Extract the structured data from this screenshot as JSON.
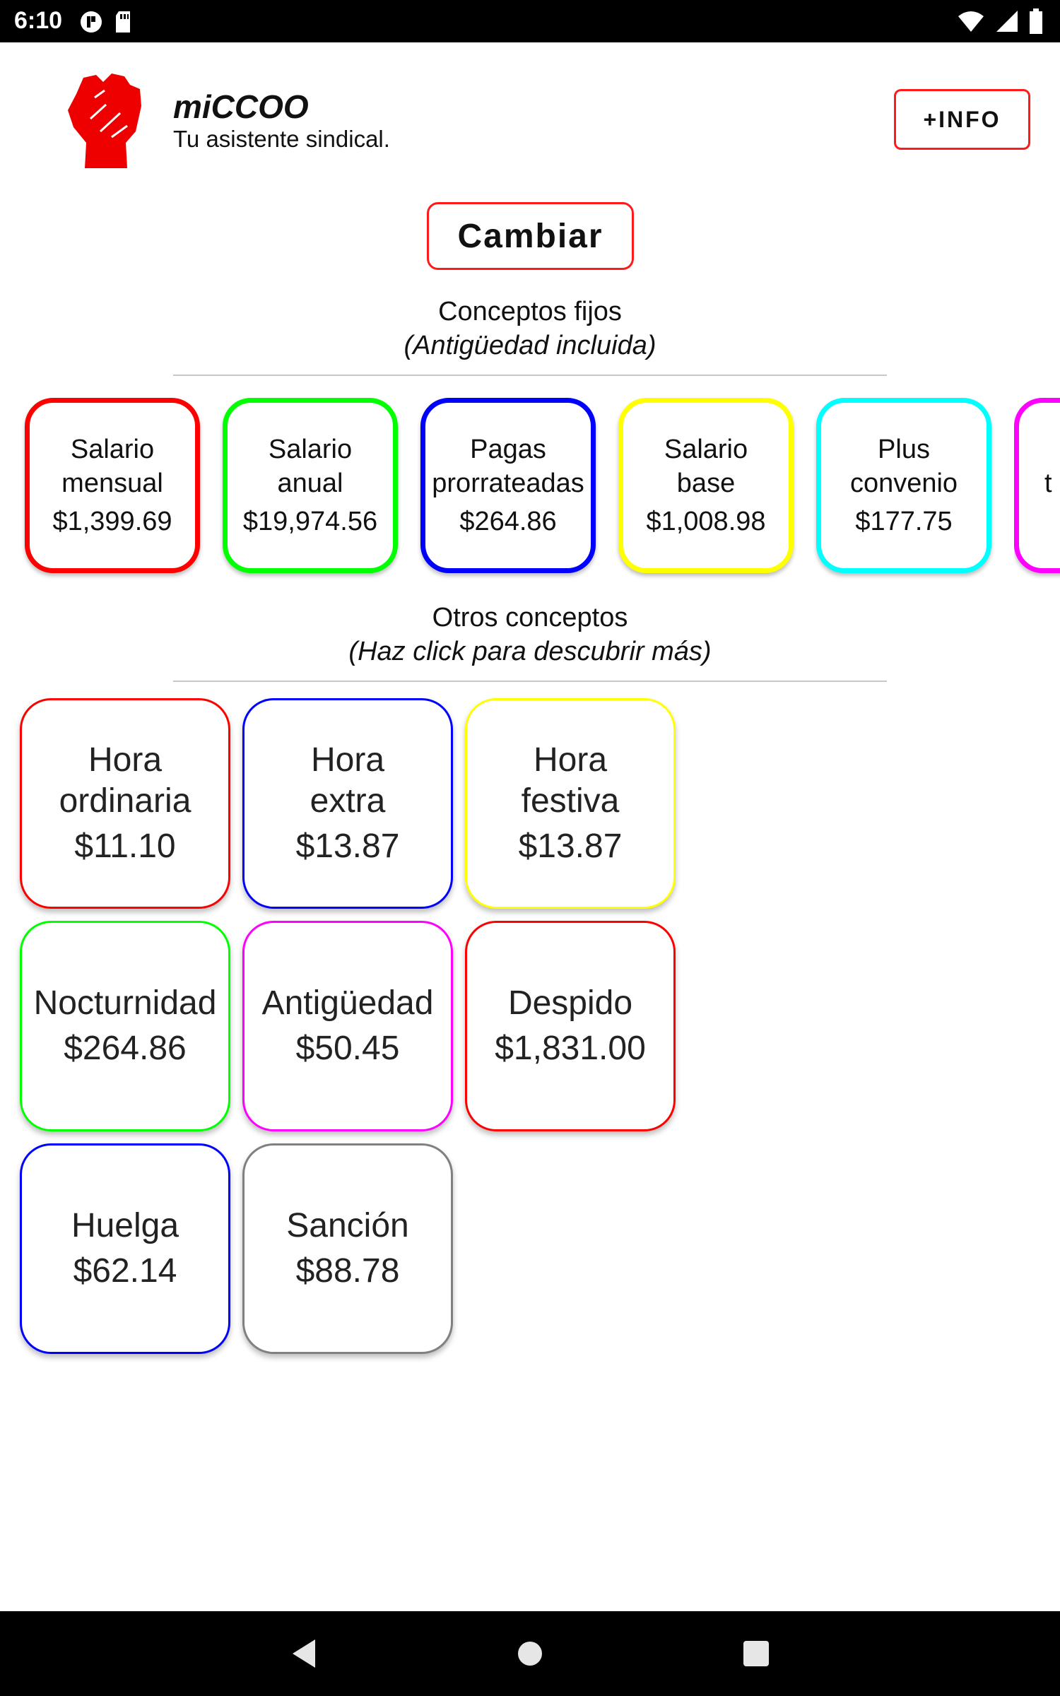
{
  "status_bar": {
    "time": "6:10",
    "icons": [
      "notification-icon",
      "sd-card-icon",
      "wifi-icon",
      "signal-icon",
      "battery-icon"
    ]
  },
  "header": {
    "title": "miCCOO",
    "subtitle": "Tu asistente sindical.",
    "info_label": "+INFO"
  },
  "change_button_label": "Cambiar",
  "fixed_section": {
    "title": "Conceptos fijos",
    "subtitle": "(Antigüedad incluida)",
    "cards": [
      {
        "line1": "Salario",
        "line2": "mensual",
        "value": "$1,399.69",
        "color": "#ff0000"
      },
      {
        "line1": "Salario",
        "line2": "anual",
        "value": "$19,974.56",
        "color": "#00ff00"
      },
      {
        "line1": "Pagas",
        "line2": "prorrateadas",
        "value": "$264.86",
        "color": "#0000ff"
      },
      {
        "line1": "Salario",
        "line2": "base",
        "value": "$1,008.98",
        "color": "#ffff00"
      },
      {
        "line1": "Plus",
        "line2": "convenio",
        "value": "$177.75",
        "color": "#00ffff"
      },
      {
        "line1": "",
        "line2": "t",
        "value": "",
        "color": "#ff00ff"
      }
    ]
  },
  "other_section": {
    "title": "Otros conceptos",
    "subtitle": "(Haz click para descubrir más)",
    "cards": [
      {
        "line1": "Hora",
        "line2": "ordinaria",
        "value": "$11.10",
        "color": "#ff0000"
      },
      {
        "line1": "Hora",
        "line2": "extra",
        "value": "$13.87",
        "color": "#0000ff"
      },
      {
        "line1": "Hora",
        "line2": "festiva",
        "value": "$13.87",
        "color": "#ffff00"
      },
      {
        "line1": "Nocturnidad",
        "line2": "",
        "value": "$264.86",
        "color": "#00ff00"
      },
      {
        "line1": "Antigüedad",
        "line2": "",
        "value": "$50.45",
        "color": "#ff00ff"
      },
      {
        "line1": "Despido",
        "line2": "",
        "value": "$1,831.00",
        "color": "#ff0000"
      },
      {
        "line1": "Huelga",
        "line2": "",
        "value": "$62.14",
        "color": "#0000ff"
      },
      {
        "line1": "Sanción",
        "line2": "",
        "value": "$88.78",
        "color": "#808080"
      }
    ]
  },
  "nav_bar": {
    "buttons": [
      "back-icon",
      "home-icon",
      "recents-icon"
    ]
  }
}
